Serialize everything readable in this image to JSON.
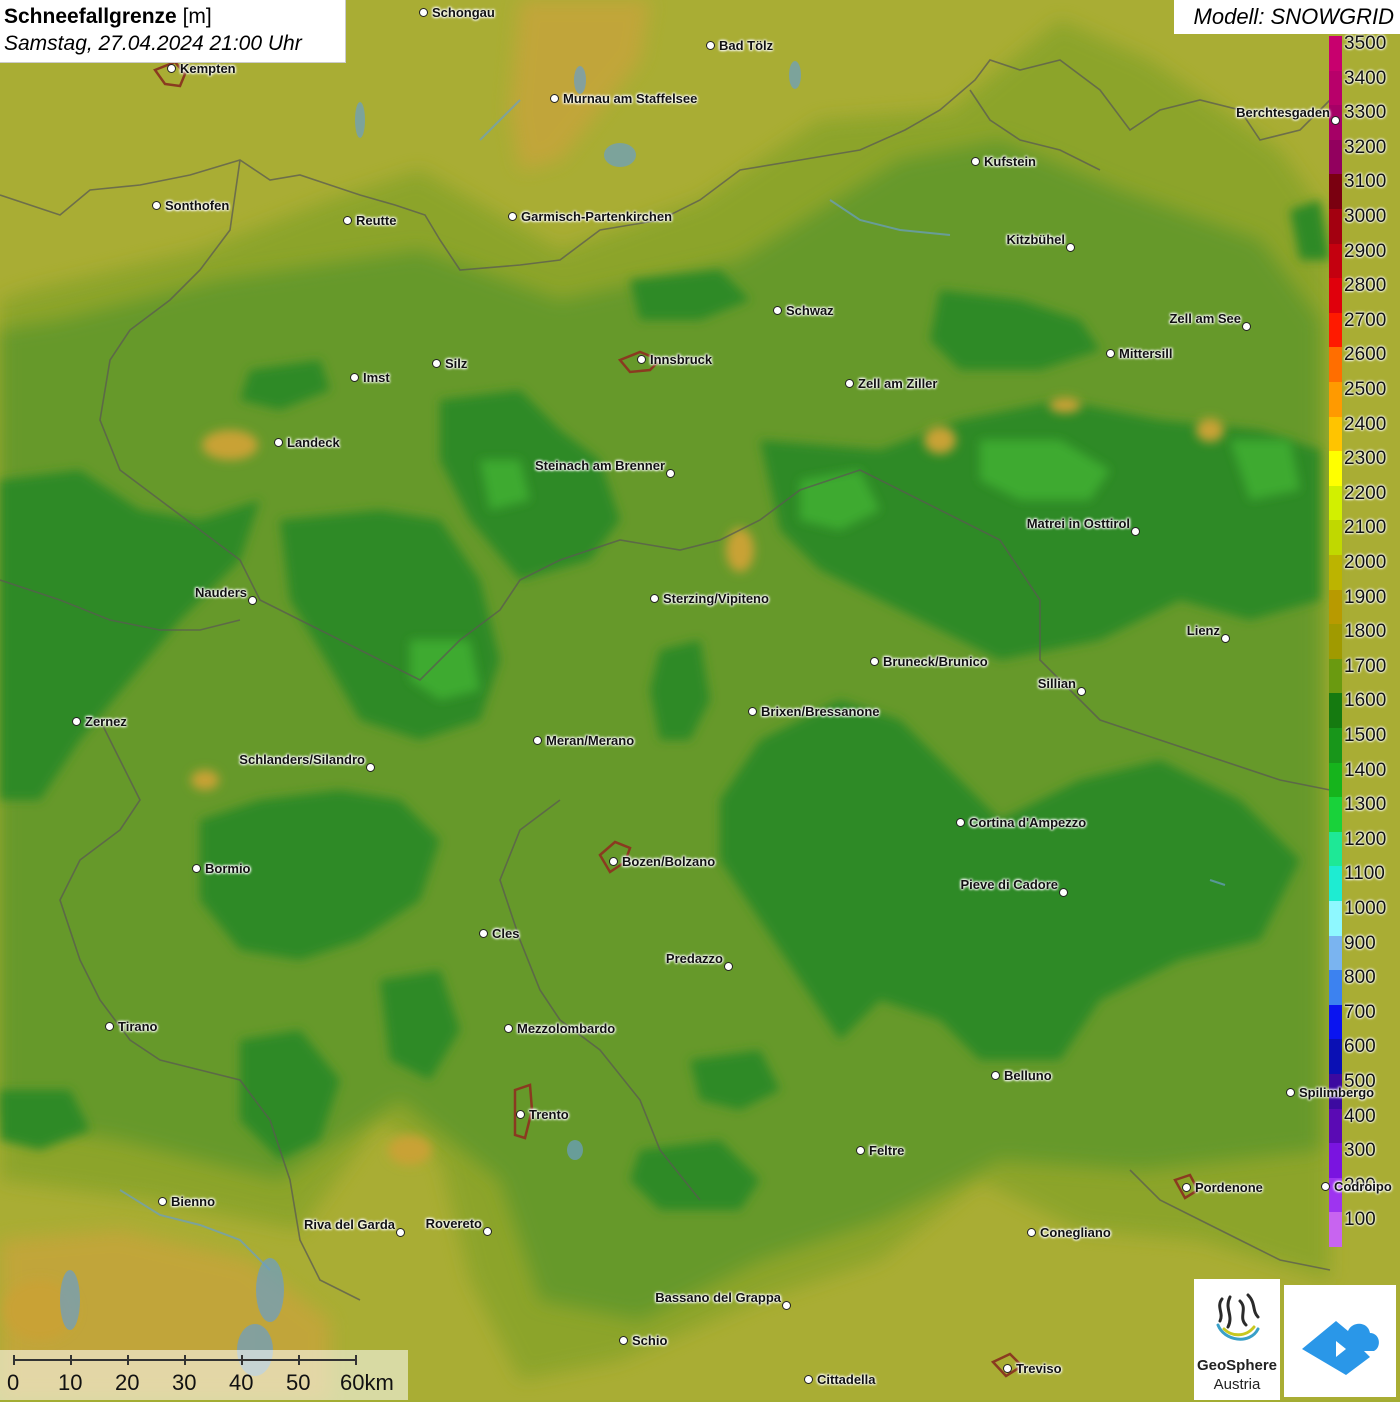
{
  "title": {
    "main": "Schneefallgrenze",
    "unit": "[m]",
    "datetime": "Samstag, 27.04.2024 21:00 Uhr"
  },
  "model": "Modell: SNOWGRID",
  "legend": {
    "levels": [
      {
        "value": "3500",
        "color": "#c8006e"
      },
      {
        "value": "3400",
        "color": "#b8006a"
      },
      {
        "value": "3300",
        "color": "#a60066"
      },
      {
        "value": "3200",
        "color": "#92005e"
      },
      {
        "value": "3100",
        "color": "#7a0010"
      },
      {
        "value": "3000",
        "color": "#a30010"
      },
      {
        "value": "2900",
        "color": "#c4000f"
      },
      {
        "value": "2800",
        "color": "#e0000c"
      },
      {
        "value": "2700",
        "color": "#ff1a00"
      },
      {
        "value": "2600",
        "color": "#ff6e00"
      },
      {
        "value": "2500",
        "color": "#ff9a00"
      },
      {
        "value": "2400",
        "color": "#ffc400"
      },
      {
        "value": "2300",
        "color": "#ffff00"
      },
      {
        "value": "2200",
        "color": "#d2f000"
      },
      {
        "value": "2100",
        "color": "#c0d800"
      },
      {
        "value": "2000",
        "color": "#bcb400"
      },
      {
        "value": "1900",
        "color": "#b89a00"
      },
      {
        "value": "1800",
        "color": "#a09a00"
      },
      {
        "value": "1700",
        "color": "#6a9a10"
      },
      {
        "value": "1600",
        "color": "#157a10"
      },
      {
        "value": "1500",
        "color": "#18961a"
      },
      {
        "value": "1400",
        "color": "#16b41c"
      },
      {
        "value": "1300",
        "color": "#19d23a"
      },
      {
        "value": "1200",
        "color": "#1ee896"
      },
      {
        "value": "1100",
        "color": "#1eecd2"
      },
      {
        "value": "1000",
        "color": "#8ef8ff"
      },
      {
        "value": "900",
        "color": "#7ab4f0"
      },
      {
        "value": "800",
        "color": "#3c82f0"
      },
      {
        "value": "700",
        "color": "#0a14f0"
      },
      {
        "value": "600",
        "color": "#0a10b4"
      },
      {
        "value": "500",
        "color": "#3c0aa0"
      },
      {
        "value": "400",
        "color": "#5a0ab4"
      },
      {
        "value": "300",
        "color": "#7a14e0"
      },
      {
        "value": "200",
        "color": "#9e34f0"
      },
      {
        "value": "100",
        "color": "#c864f0"
      }
    ]
  },
  "cities": [
    {
      "name": "Schongau",
      "side": "right"
    },
    {
      "name": "Bad Tölz",
      "side": "right"
    },
    {
      "name": "Kempten",
      "side": "right"
    },
    {
      "name": "Murnau am Staffelsee",
      "side": "right"
    },
    {
      "name": "Berchtesgaden",
      "side": "left"
    },
    {
      "name": "Kufstein",
      "side": "right"
    },
    {
      "name": "Sonthofen",
      "side": "right"
    },
    {
      "name": "Reutte",
      "side": "right"
    },
    {
      "name": "Garmisch-Partenkirchen",
      "side": "right"
    },
    {
      "name": "Kitzbühel",
      "side": "left"
    },
    {
      "name": "Schwaz",
      "side": "right"
    },
    {
      "name": "Zell am See",
      "side": "left"
    },
    {
      "name": "Innsbruck",
      "side": "right"
    },
    {
      "name": "Mittersill",
      "side": "right"
    },
    {
      "name": "Imst",
      "side": "right"
    },
    {
      "name": "Silz",
      "side": "right"
    },
    {
      "name": "Zell am Ziller",
      "side": "right"
    },
    {
      "name": "Landeck",
      "side": "right"
    },
    {
      "name": "Steinach am Brenner",
      "side": "left"
    },
    {
      "name": "Matrei in Osttirol",
      "side": "left"
    },
    {
      "name": "Nauders",
      "side": "left"
    },
    {
      "name": "Sterzing/Vipiteno",
      "side": "right"
    },
    {
      "name": "Lienz",
      "side": "left"
    },
    {
      "name": "Bruneck/Brunico",
      "side": "right"
    },
    {
      "name": "Sillian",
      "side": "left"
    },
    {
      "name": "Zernez",
      "side": "right"
    },
    {
      "name": "Brixen/Bressanone",
      "side": "right"
    },
    {
      "name": "Meran/Merano",
      "side": "right"
    },
    {
      "name": "Schlanders/Silandro",
      "side": "left"
    },
    {
      "name": "Cortina d'Ampezzo",
      "side": "right"
    },
    {
      "name": "Bozen/Bolzano",
      "side": "right"
    },
    {
      "name": "Bormio",
      "side": "right"
    },
    {
      "name": "Pieve di Cadore",
      "side": "left"
    },
    {
      "name": "Cles",
      "side": "right"
    },
    {
      "name": "Predazzo",
      "side": "left"
    },
    {
      "name": "Tirano",
      "side": "right"
    },
    {
      "name": "Mezzolombardo",
      "side": "right"
    },
    {
      "name": "Belluno",
      "side": "right"
    },
    {
      "name": "Spilimbergo",
      "side": "right"
    },
    {
      "name": "Trento",
      "side": "right"
    },
    {
      "name": "Feltre",
      "side": "right"
    },
    {
      "name": "Pordenone",
      "side": "right"
    },
    {
      "name": "Codroipo",
      "side": "right"
    },
    {
      "name": "Bienno",
      "side": "right"
    },
    {
      "name": "Riva del Garda",
      "side": "left"
    },
    {
      "name": "Rovereto",
      "side": "left"
    },
    {
      "name": "Conegliano",
      "side": "right"
    },
    {
      "name": "Bassano del Grappa",
      "side": "left"
    },
    {
      "name": "Schio",
      "side": "right"
    },
    {
      "name": "Treviso",
      "side": "right"
    },
    {
      "name": "Cittadella",
      "side": "right"
    }
  ],
  "scale": {
    "ticks": [
      "0",
      "10",
      "20",
      "30",
      "40",
      "50",
      "60km"
    ]
  },
  "logos": {
    "geosphere_line1": "GeoSphere",
    "geosphere_line2": "Austria",
    "geosphere_icon": "geosphere-logo-icon",
    "cloud_icon": "cloud-arrow-icon"
  }
}
